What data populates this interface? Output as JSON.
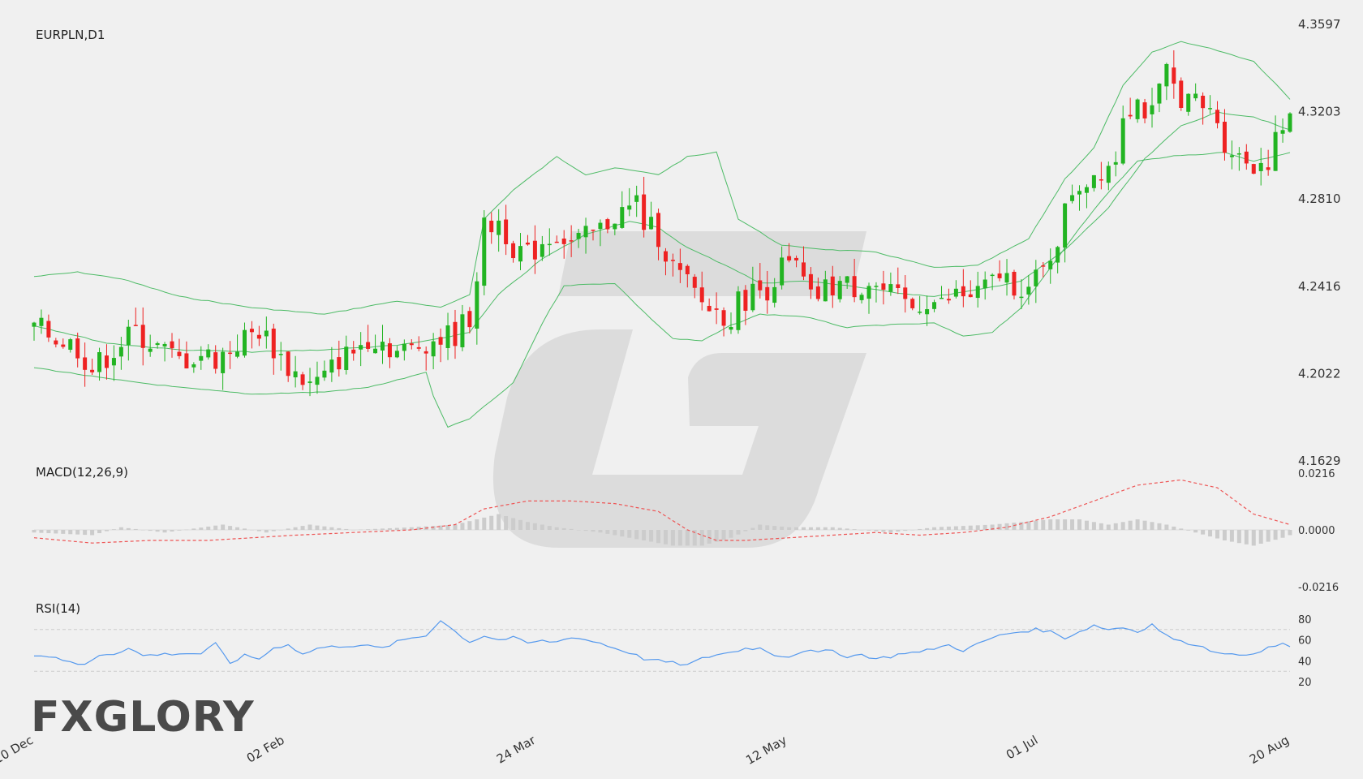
{
  "brand": {
    "logo_text": "FXGLORY",
    "accent": "#e8772e"
  },
  "chart_data": {
    "type": "candlestick",
    "symbol": "EURPLN,D1",
    "colors": {
      "up": "#22b422",
      "down": "#ee2222",
      "bands": "#4dbb66",
      "macd_signal": "#ee5555",
      "macd_hist": "#cccccc",
      "rsi": "#5599ee"
    },
    "y_ticks": [
      "4.3597",
      "4.3203",
      "4.2810",
      "4.2416",
      "4.2022",
      "4.1629"
    ],
    "ylim": [
      4.1629,
      4.3597
    ],
    "x_ticks": [
      "10 Dec",
      "02 Feb",
      "24 Mar",
      "12 May",
      "01 Jul",
      "20 Aug"
    ],
    "bars": 174,
    "close_path": [
      [
        0,
        4.223
      ],
      [
        6,
        4.214
      ],
      [
        8,
        4.204
      ],
      [
        12,
        4.216
      ],
      [
        14,
        4.221
      ],
      [
        17,
        4.214
      ],
      [
        20,
        4.208
      ],
      [
        23,
        4.211
      ],
      [
        25,
        4.209
      ],
      [
        27,
        4.213
      ],
      [
        29,
        4.218
      ],
      [
        31,
        4.222
      ],
      [
        33,
        4.214
      ],
      [
        35,
        4.205
      ],
      [
        38,
        4.197
      ],
      [
        40,
        4.2
      ],
      [
        42,
        4.209
      ],
      [
        44,
        4.212
      ],
      [
        46,
        4.219
      ],
      [
        48,
        4.217
      ],
      [
        50,
        4.212
      ],
      [
        52,
        4.213
      ],
      [
        54,
        4.217
      ],
      [
        56,
        4.218
      ],
      [
        58,
        4.22
      ],
      [
        60,
        4.228
      ],
      [
        62,
        4.267
      ],
      [
        64,
        4.271
      ],
      [
        66,
        4.26
      ],
      [
        68,
        4.255
      ],
      [
        70,
        4.262
      ],
      [
        72,
        4.266
      ],
      [
        74,
        4.261
      ],
      [
        76,
        4.263
      ],
      [
        78,
        4.267
      ],
      [
        80,
        4.274
      ],
      [
        82,
        4.276
      ],
      [
        83,
        4.28
      ],
      [
        84,
        4.27
      ],
      [
        86,
        4.265
      ],
      [
        88,
        4.25
      ],
      [
        90,
        4.242
      ],
      [
        92,
        4.234
      ],
      [
        94,
        4.23
      ],
      [
        96,
        4.228
      ],
      [
        97,
        4.234
      ],
      [
        99,
        4.239
      ],
      [
        101,
        4.241
      ],
      [
        103,
        4.25
      ],
      [
        105,
        4.25
      ],
      [
        107,
        4.235
      ],
      [
        109,
        4.24
      ],
      [
        111,
        4.243
      ],
      [
        113,
        4.241
      ],
      [
        115,
        4.244
      ],
      [
        117,
        4.239
      ],
      [
        119,
        4.235
      ],
      [
        121,
        4.232
      ],
      [
        123,
        4.236
      ],
      [
        125,
        4.233
      ],
      [
        127,
        4.238
      ],
      [
        129,
        4.237
      ],
      [
        131,
        4.24
      ],
      [
        133,
        4.247
      ],
      [
        135,
        4.243
      ],
      [
        137,
        4.24
      ],
      [
        139,
        4.248
      ],
      [
        141,
        4.264
      ],
      [
        143,
        4.285
      ],
      [
        145,
        4.29
      ],
      [
        147,
        4.295
      ],
      [
        149,
        4.3
      ],
      [
        150,
        4.322
      ],
      [
        152,
        4.325
      ],
      [
        154,
        4.318
      ],
      [
        156,
        4.338
      ],
      [
        157,
        4.331
      ],
      [
        159,
        4.325
      ],
      [
        161,
        4.322
      ],
      [
        163,
        4.317
      ],
      [
        164,
        4.307
      ],
      [
        166,
        4.3
      ],
      [
        168,
        4.297
      ],
      [
        170,
        4.299
      ],
      [
        172,
        4.313
      ],
      [
        173,
        4.315
      ]
    ],
    "bands_path": {
      "upper": [
        [
          0,
          4.246
        ],
        [
          6,
          4.248
        ],
        [
          12,
          4.245
        ],
        [
          20,
          4.237
        ],
        [
          30,
          4.232
        ],
        [
          40,
          4.229
        ],
        [
          50,
          4.235
        ],
        [
          56,
          4.232
        ],
        [
          60,
          4.238
        ],
        [
          62,
          4.272
        ],
        [
          66,
          4.285
        ],
        [
          72,
          4.3
        ],
        [
          76,
          4.292
        ],
        [
          80,
          4.295
        ],
        [
          86,
          4.292
        ],
        [
          90,
          4.3
        ],
        [
          94,
          4.302
        ],
        [
          97,
          4.272
        ],
        [
          103,
          4.26
        ],
        [
          110,
          4.258
        ],
        [
          116,
          4.257
        ],
        [
          124,
          4.25
        ],
        [
          130,
          4.251
        ],
        [
          137,
          4.263
        ],
        [
          142,
          4.29
        ],
        [
          146,
          4.304
        ],
        [
          150,
          4.332
        ],
        [
          154,
          4.347
        ],
        [
          158,
          4.352
        ],
        [
          163,
          4.348
        ],
        [
          168,
          4.343
        ],
        [
          171,
          4.333
        ],
        [
          173,
          4.326
        ]
      ],
      "middle": [
        [
          0,
          4.224
        ],
        [
          10,
          4.216
        ],
        [
          20,
          4.213
        ],
        [
          30,
          4.212
        ],
        [
          40,
          4.213
        ],
        [
          50,
          4.215
        ],
        [
          56,
          4.218
        ],
        [
          60,
          4.221
        ],
        [
          64,
          4.238
        ],
        [
          70,
          4.254
        ],
        [
          76,
          4.265
        ],
        [
          82,
          4.271
        ],
        [
          86,
          4.268
        ],
        [
          90,
          4.259
        ],
        [
          96,
          4.25
        ],
        [
          100,
          4.243
        ],
        [
          106,
          4.244
        ],
        [
          112,
          4.242
        ],
        [
          118,
          4.239
        ],
        [
          124,
          4.237
        ],
        [
          130,
          4.24
        ],
        [
          136,
          4.244
        ],
        [
          142,
          4.258
        ],
        [
          148,
          4.277
        ],
        [
          153,
          4.299
        ],
        [
          158,
          4.314
        ],
        [
          163,
          4.32
        ],
        [
          168,
          4.318
        ],
        [
          173,
          4.312
        ]
      ],
      "lower": [
        [
          0,
          4.205
        ],
        [
          10,
          4.2
        ],
        [
          20,
          4.196
        ],
        [
          30,
          4.193
        ],
        [
          40,
          4.194
        ],
        [
          46,
          4.196
        ],
        [
          52,
          4.201
        ],
        [
          54,
          4.203
        ],
        [
          55,
          4.192
        ],
        [
          57,
          4.178
        ],
        [
          60,
          4.182
        ],
        [
          66,
          4.198
        ],
        [
          70,
          4.225
        ],
        [
          73,
          4.242
        ],
        [
          80,
          4.243
        ],
        [
          84,
          4.23
        ],
        [
          88,
          4.218
        ],
        [
          92,
          4.217
        ],
        [
          96,
          4.224
        ],
        [
          100,
          4.229
        ],
        [
          106,
          4.228
        ],
        [
          112,
          4.223
        ],
        [
          116,
          4.224
        ],
        [
          124,
          4.225
        ],
        [
          128,
          4.219
        ],
        [
          132,
          4.221
        ],
        [
          136,
          4.232
        ],
        [
          140,
          4.25
        ],
        [
          144,
          4.268
        ],
        [
          148,
          4.284
        ],
        [
          152,
          4.298
        ],
        [
          156,
          4.3
        ],
        [
          160,
          4.301
        ],
        [
          164,
          4.302
        ],
        [
          168,
          4.298
        ],
        [
          173,
          4.302
        ]
      ]
    },
    "macd": {
      "label": "MACD(12,26,9)",
      "y_ticks": [
        "0.0216",
        "0.0000",
        "-0.0216"
      ],
      "ylim": [
        -0.0216,
        0.0216
      ],
      "signal_path": [
        [
          0,
          -0.003
        ],
        [
          8,
          -0.005
        ],
        [
          16,
          -0.004
        ],
        [
          24,
          -0.004
        ],
        [
          30,
          -0.003
        ],
        [
          36,
          -0.002
        ],
        [
          44,
          -0.001
        ],
        [
          52,
          0.0
        ],
        [
          58,
          0.002
        ],
        [
          62,
          0.008
        ],
        [
          68,
          0.011
        ],
        [
          74,
          0.011
        ],
        [
          80,
          0.01
        ],
        [
          86,
          0.007
        ],
        [
          90,
          0.0
        ],
        [
          94,
          -0.004
        ],
        [
          98,
          -0.004
        ],
        [
          104,
          -0.003
        ],
        [
          110,
          -0.002
        ],
        [
          116,
          -0.001
        ],
        [
          122,
          -0.002
        ],
        [
          128,
          -0.001
        ],
        [
          134,
          0.001
        ],
        [
          140,
          0.005
        ],
        [
          146,
          0.011
        ],
        [
          152,
          0.017
        ],
        [
          158,
          0.019
        ],
        [
          163,
          0.016
        ],
        [
          168,
          0.006
        ],
        [
          173,
          0.002
        ]
      ],
      "hist_path": [
        [
          0,
          -0.001
        ],
        [
          8,
          -0.002
        ],
        [
          12,
          0.001
        ],
        [
          18,
          -0.001
        ],
        [
          26,
          0.002
        ],
        [
          32,
          -0.001
        ],
        [
          38,
          0.002
        ],
        [
          44,
          0.0
        ],
        [
          52,
          0.001
        ],
        [
          58,
          0.002
        ],
        [
          61,
          0.004
        ],
        [
          64,
          0.006
        ],
        [
          68,
          0.003
        ],
        [
          72,
          0.001
        ],
        [
          78,
          -0.001
        ],
        [
          84,
          -0.004
        ],
        [
          88,
          -0.006
        ],
        [
          92,
          -0.006
        ],
        [
          96,
          -0.003
        ],
        [
          100,
          0.002
        ],
        [
          104,
          0.001
        ],
        [
          110,
          0.001
        ],
        [
          118,
          -0.001
        ],
        [
          124,
          0.001
        ],
        [
          132,
          0.002
        ],
        [
          136,
          0.003
        ],
        [
          140,
          0.004
        ],
        [
          144,
          0.004
        ],
        [
          148,
          0.002
        ],
        [
          152,
          0.004
        ],
        [
          156,
          0.002
        ],
        [
          160,
          -0.001
        ],
        [
          164,
          -0.004
        ],
        [
          168,
          -0.006
        ],
        [
          172,
          -0.003
        ],
        [
          173,
          -0.002
        ]
      ]
    },
    "rsi": {
      "label": "RSI(14)",
      "y_ticks": [
        "80",
        "60",
        "40",
        "20"
      ],
      "ylim": [
        10,
        90
      ],
      "levels": [
        30,
        70
      ],
      "path": [
        [
          0,
          45
        ],
        [
          3,
          44
        ],
        [
          5,
          38
        ],
        [
          7,
          36
        ],
        [
          9,
          46
        ],
        [
          11,
          47
        ],
        [
          13,
          52
        ],
        [
          15,
          45
        ],
        [
          17,
          46
        ],
        [
          20,
          47
        ],
        [
          23,
          47
        ],
        [
          25,
          56
        ],
        [
          27,
          38
        ],
        [
          29,
          45
        ],
        [
          31,
          42
        ],
        [
          33,
          52
        ],
        [
          35,
          56
        ],
        [
          37,
          46
        ],
        [
          39,
          52
        ],
        [
          42,
          54
        ],
        [
          45,
          55
        ],
        [
          48,
          52
        ],
        [
          50,
          58
        ],
        [
          52,
          62
        ],
        [
          54,
          64
        ],
        [
          55,
          72
        ],
        [
          56,
          79
        ],
        [
          58,
          68
        ],
        [
          60,
          58
        ],
        [
          62,
          64
        ],
        [
          64,
          60
        ],
        [
          66,
          62
        ],
        [
          68,
          57
        ],
        [
          70,
          59
        ],
        [
          72,
          58
        ],
        [
          74,
          63
        ],
        [
          76,
          60
        ],
        [
          78,
          57
        ],
        [
          80,
          52
        ],
        [
          82,
          48
        ],
        [
          84,
          42
        ],
        [
          86,
          40
        ],
        [
          88,
          38
        ],
        [
          90,
          36
        ],
        [
          92,
          42
        ],
        [
          94,
          46
        ],
        [
          96,
          48
        ],
        [
          98,
          52
        ],
        [
          100,
          52
        ],
        [
          102,
          46
        ],
        [
          104,
          44
        ],
        [
          106,
          50
        ],
        [
          108,
          48
        ],
        [
          110,
          50
        ],
        [
          112,
          44
        ],
        [
          114,
          46
        ],
        [
          116,
          42
        ],
        [
          118,
          44
        ],
        [
          120,
          48
        ],
        [
          122,
          48
        ],
        [
          124,
          52
        ],
        [
          126,
          55
        ],
        [
          128,
          50
        ],
        [
          130,
          56
        ],
        [
          132,
          62
        ],
        [
          134,
          66
        ],
        [
          136,
          68
        ],
        [
          138,
          70
        ],
        [
          140,
          68
        ],
        [
          142,
          62
        ],
        [
          144,
          68
        ],
        [
          146,
          74
        ],
        [
          148,
          70
        ],
        [
          150,
          72
        ],
        [
          152,
          68
        ],
        [
          154,
          75
        ],
        [
          156,
          64
        ],
        [
          158,
          58
        ],
        [
          160,
          56
        ],
        [
          162,
          50
        ],
        [
          164,
          48
        ],
        [
          166,
          44
        ],
        [
          168,
          48
        ],
        [
          170,
          52
        ],
        [
          172,
          56
        ],
        [
          173,
          54
        ]
      ]
    }
  }
}
